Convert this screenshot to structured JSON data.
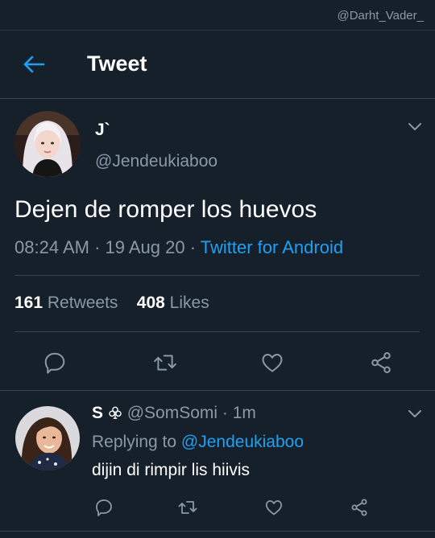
{
  "watermark": "@Darht_Vader_",
  "header": {
    "title": "Tweet"
  },
  "tweet": {
    "name": "J`",
    "handle": "@Jendeukiaboo",
    "text": "Dejen de romper los huevos",
    "time": "08:24 AM",
    "date": "19 Aug 20",
    "source": "Twitter for Android",
    "retweets_count": "161",
    "retweets_label": "Retweets",
    "likes_count": "408",
    "likes_label": "Likes"
  },
  "reply": {
    "name": "S",
    "handle": "@SomSomi",
    "time_ago": "1m",
    "replying_label": "Replying to",
    "replying_handle": "@Jendeukiaboo",
    "text": "dijin di rimpir lis hiivis"
  },
  "colors": {
    "background": "#15202b",
    "accent": "#1da1f2",
    "muted": "#8b98a5",
    "divider": "#38444d"
  },
  "icons": [
    "back-arrow-icon",
    "chevron-down-icon",
    "comment-icon",
    "retweet-icon",
    "like-icon",
    "share-icon",
    "club-suit-icon"
  ]
}
